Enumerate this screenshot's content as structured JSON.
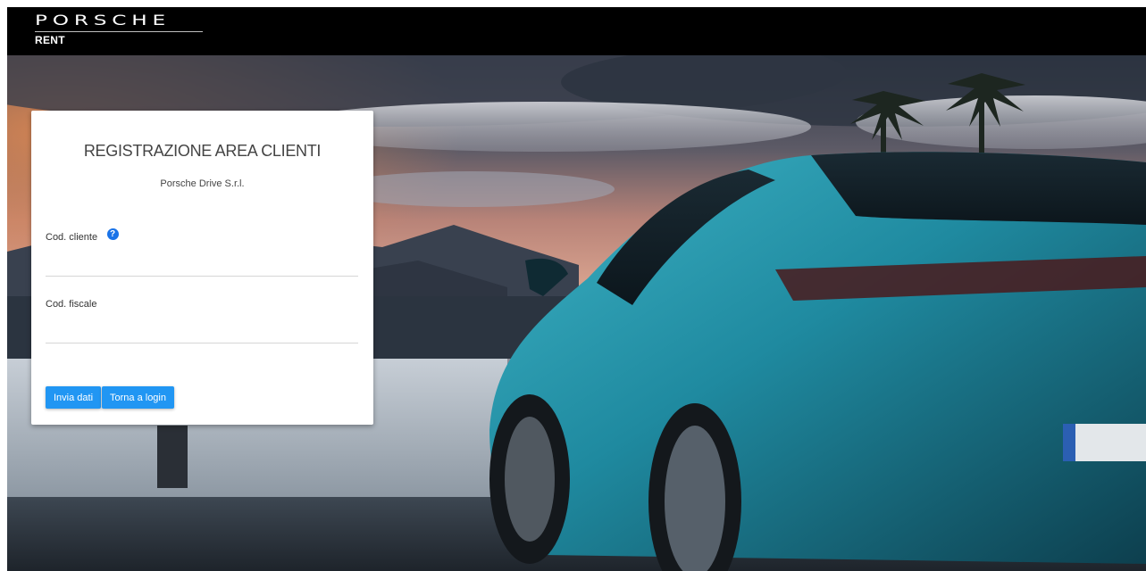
{
  "header": {
    "brand": "PORSCHE",
    "brand_sub": "RENT"
  },
  "card": {
    "title": "REGISTRAZIONE AREA CLIENTI",
    "subtitle": "Porsche Drive S.r.l.",
    "fields": [
      {
        "label": "Cod. cliente",
        "value": "",
        "has_help_icon": true
      },
      {
        "label": "Cod. fiscale",
        "value": ""
      }
    ],
    "help_icon_glyph": "?",
    "buttons": {
      "submit": "Invia dati",
      "back": "Torna a login"
    }
  },
  "colors": {
    "topbar": "#000000",
    "accent": "#2196f3",
    "help_icon": "#1a73e8"
  }
}
